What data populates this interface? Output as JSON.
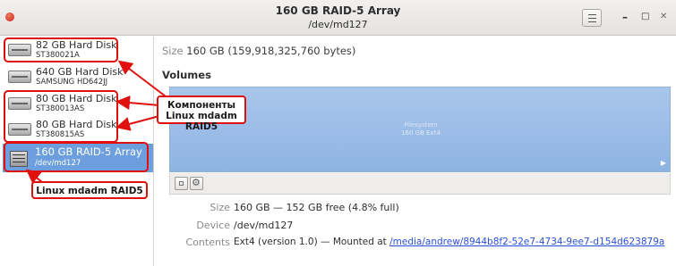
{
  "window": {
    "title": "160 GB RAID-5 Array",
    "subtitle": "/dev/md127",
    "buttons": {
      "minimize": "–",
      "maximize": "□",
      "close": "✕"
    }
  },
  "sidebar": {
    "items": [
      {
        "name": "82 GB Hard Disk",
        "sub": "ST380021A"
      },
      {
        "name": "640 GB Hard Disk",
        "sub": "SAMSUNG HD642JJ"
      },
      {
        "name": "80 GB Hard Disk",
        "sub": "ST380013AS"
      },
      {
        "name": "80 GB Hard Disk",
        "sub": "ST380815AS"
      },
      {
        "name": "160 GB RAID-5 Array",
        "sub": "/dev/md127",
        "selected": true
      }
    ]
  },
  "annotations": {
    "components": "Компоненты Linux mdadm RAID5",
    "raid": "Linux mdadm RAID5"
  },
  "main": {
    "size_label": "Size",
    "size_value": "160 GB (159,918,325,760 bytes)",
    "volumes_title": "Volumes",
    "volume": {
      "line1": "Filesystem",
      "line2": "160 GB Ext4"
    },
    "details": {
      "size_label": "Size",
      "size_value": "160 GB — 152 GB free (4.8% full)",
      "device_label": "Device",
      "device_value": "/dev/md127",
      "contents_label": "Contents",
      "contents_value": "Ext4 (version 1.0) — Mounted at ",
      "contents_link": "/media/andrew/8944b8f2-52e7-4734-9ee7-d154d623879a"
    }
  },
  "colors": {
    "selection": "#6d9fdf",
    "annotation": "#e0100e",
    "volume": "#9dbde8",
    "link": "#2a4fd7"
  }
}
